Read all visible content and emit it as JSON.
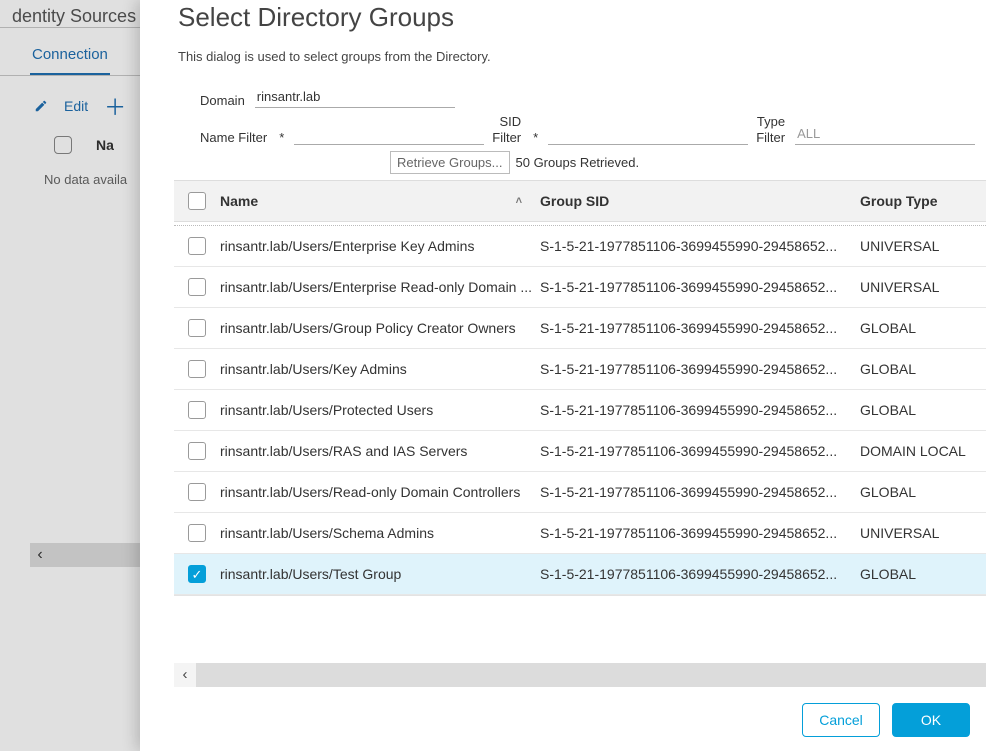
{
  "backdrop": {
    "title": "dentity Sources",
    "tab": "Connection",
    "edit": "Edit",
    "col_name": "Na",
    "no_data": "No data availa"
  },
  "dialog": {
    "title": "Select Directory Groups",
    "description": "This dialog is used to select groups from the Directory.",
    "domain_label": "Domain",
    "domain_value": "rinsantr.lab",
    "name_filter_label": "Name Filter",
    "sid_filter_label_line1": "SID",
    "sid_filter_label_line2": "Filter",
    "type_filter_label_line1": "Type",
    "type_filter_label_line2": "Filter",
    "type_filter_value": "ALL",
    "retrieve_btn": "Retrieve Groups...",
    "retrieve_count": "50 Groups Retrieved.",
    "columns": {
      "name": "Name",
      "sid": "Group SID",
      "type": "Group Type"
    },
    "rows": [
      {
        "name": "rinsantr.lab/Users/Enterprise Key Admins",
        "sid": "S-1-5-21-1977851106-3699455990-29458652...",
        "type": "UNIVERSAL",
        "checked": false
      },
      {
        "name": "rinsantr.lab/Users/Enterprise Read-only Domain ...",
        "sid": "S-1-5-21-1977851106-3699455990-29458652...",
        "type": "UNIVERSAL",
        "checked": false
      },
      {
        "name": "rinsantr.lab/Users/Group Policy Creator Owners",
        "sid": "S-1-5-21-1977851106-3699455990-29458652...",
        "type": "GLOBAL",
        "checked": false
      },
      {
        "name": "rinsantr.lab/Users/Key Admins",
        "sid": "S-1-5-21-1977851106-3699455990-29458652...",
        "type": "GLOBAL",
        "checked": false
      },
      {
        "name": "rinsantr.lab/Users/Protected Users",
        "sid": "S-1-5-21-1977851106-3699455990-29458652...",
        "type": "GLOBAL",
        "checked": false
      },
      {
        "name": "rinsantr.lab/Users/RAS and IAS Servers",
        "sid": "S-1-5-21-1977851106-3699455990-29458652...",
        "type": "DOMAIN LOCAL",
        "checked": false
      },
      {
        "name": "rinsantr.lab/Users/Read-only Domain Controllers",
        "sid": "S-1-5-21-1977851106-3699455990-29458652...",
        "type": "GLOBAL",
        "checked": false
      },
      {
        "name": "rinsantr.lab/Users/Schema Admins",
        "sid": "S-1-5-21-1977851106-3699455990-29458652...",
        "type": "UNIVERSAL",
        "checked": false
      },
      {
        "name": "rinsantr.lab/Users/Test Group",
        "sid": "S-1-5-21-1977851106-3699455990-29458652...",
        "type": "GLOBAL",
        "checked": true
      }
    ],
    "buttons": {
      "cancel": "Cancel",
      "ok": "OK"
    }
  }
}
